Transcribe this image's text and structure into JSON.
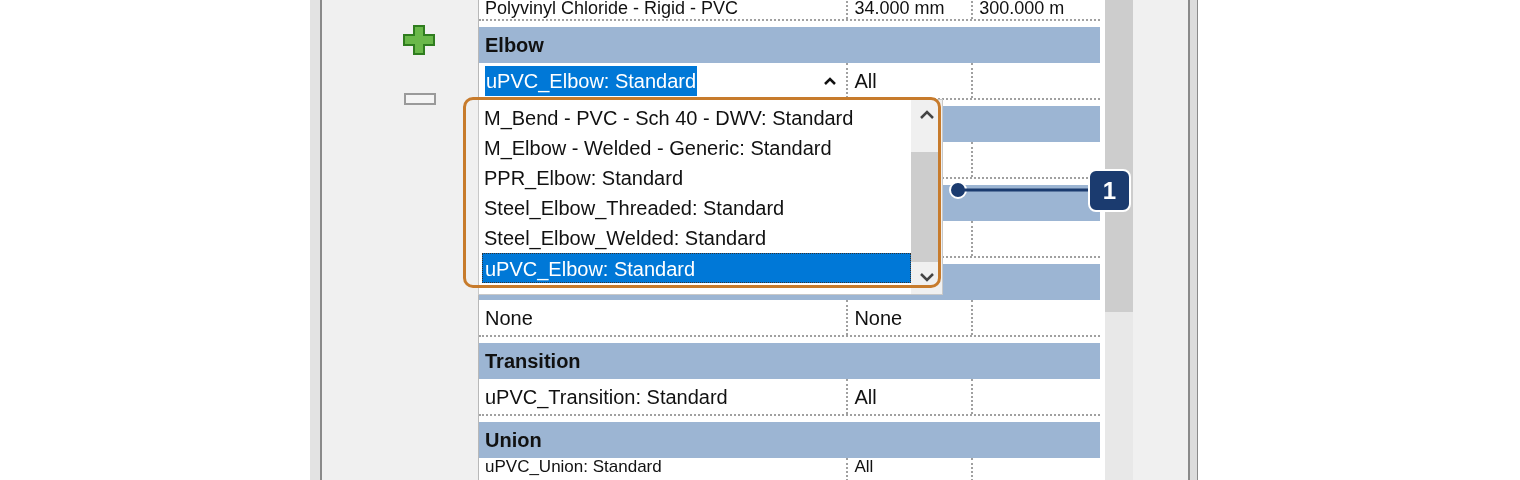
{
  "table": {
    "rows": [
      {
        "kind": "value",
        "cells": [
          "Polyvinyl Chloride - Rigid - PVC",
          "34.000 mm",
          "300.000 m"
        ]
      },
      {
        "kind": "header",
        "label": "Elbow"
      },
      {
        "kind": "combo",
        "cells": [
          "uPVC_Elbow: Standard",
          "All"
        ],
        "expanded": true
      },
      {
        "kind": "header"
      },
      {
        "kind": "value",
        "cells": []
      },
      {
        "kind": "header"
      },
      {
        "kind": "value",
        "cells": []
      },
      {
        "kind": "header"
      },
      {
        "kind": "value",
        "cells": [
          "None",
          "None"
        ]
      },
      {
        "kind": "header",
        "label": "Transition"
      },
      {
        "kind": "value",
        "cells": [
          "uPVC_Transition: Standard",
          "All"
        ]
      },
      {
        "kind": "header",
        "label": "Union"
      },
      {
        "kind": "value",
        "cells": [
          "uPVC_Union: Standard",
          "All"
        ]
      }
    ]
  },
  "dropdown": {
    "options": [
      {
        "label": "M_Bend - PVC - Sch 40 - DWV: Standard",
        "selected": false
      },
      {
        "label": "M_Elbow - Welded - Generic: Standard",
        "selected": false
      },
      {
        "label": "PPR_Elbow: Standard",
        "selected": false
      },
      {
        "label": "Steel_Elbow_Threaded: Standard",
        "selected": false
      },
      {
        "label": "Steel_Elbow_Welded: Standard",
        "selected": false
      },
      {
        "label": "uPVC_Elbow: Standard",
        "selected": true
      }
    ]
  },
  "callout": {
    "label": "1"
  }
}
